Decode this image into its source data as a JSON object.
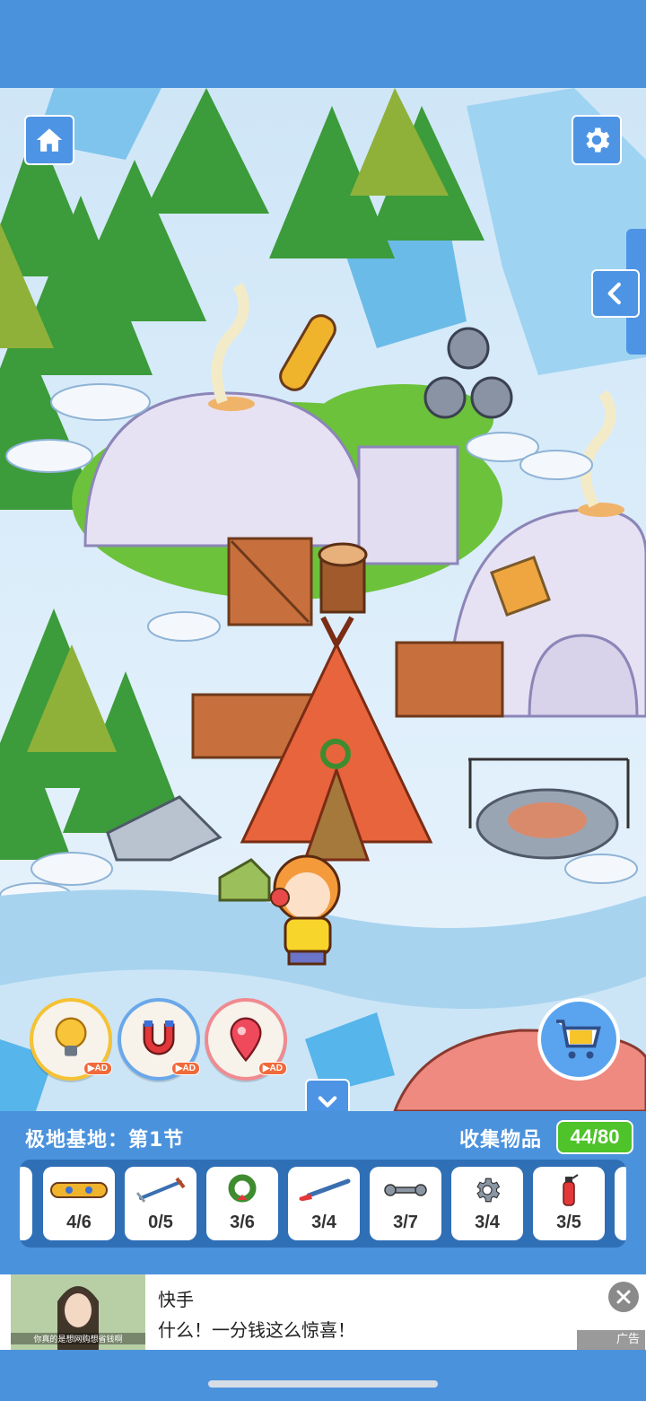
{
  "colors": {
    "bar_blue": "#4b92dd",
    "button_blue": "#4e94e4",
    "count_green": "#4ec32a",
    "tray_blue": "#2f6fb6"
  },
  "top_buttons": {
    "home_icon": "home-icon",
    "settings_icon": "gear-icon",
    "side_icon": "chevron-left-icon"
  },
  "tools": [
    {
      "name": "lightbulb-icon",
      "badge": "▶AD"
    },
    {
      "name": "magnet-icon",
      "badge": "▶AD"
    },
    {
      "name": "location-pin-icon",
      "badge": "▶AD"
    }
  ],
  "cart_icon": "shopping-cart-icon",
  "collapse_icon": "chevron-down-icon",
  "level": {
    "title": "极地基地：第1节"
  },
  "collection": {
    "label": "收集物品",
    "count": "44/80"
  },
  "items": [
    {
      "icon": "snowboard-icon",
      "count": "4/6"
    },
    {
      "icon": "ice-pick-icon",
      "count": "0/5"
    },
    {
      "icon": "wreath-icon",
      "count": "3/6"
    },
    {
      "icon": "hockey-stick-icon",
      "count": "3/4"
    },
    {
      "icon": "wrench-icon",
      "count": "3/7"
    },
    {
      "icon": "gear-icon",
      "count": "3/4"
    },
    {
      "icon": "fire-extinguisher-icon",
      "count": "3/5"
    }
  ],
  "ad": {
    "brand": "快手",
    "text": "什么！一分钱这么惊喜！",
    "tag": "广告",
    "thumb_caption": "你真的是想网购想省钱啊"
  }
}
